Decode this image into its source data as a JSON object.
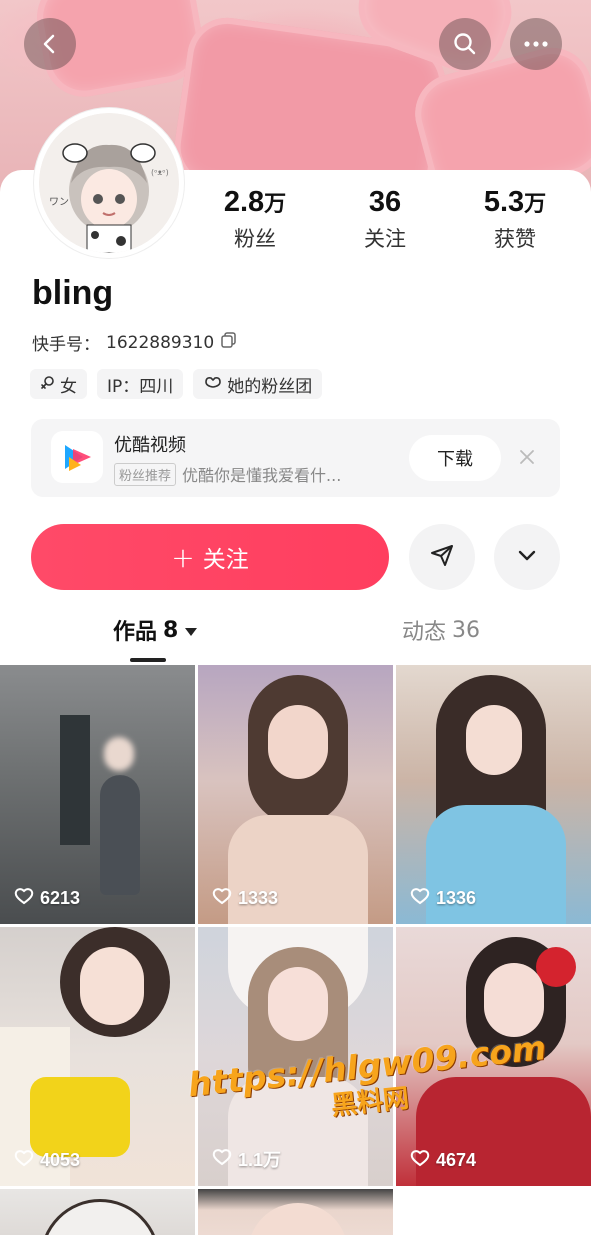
{
  "header": {
    "back_icon": "chevron-left-icon",
    "search_icon": "search-icon",
    "more_icon": "more-dots-icon"
  },
  "profile": {
    "name": "bling",
    "uid_label": "快手号：",
    "uid_value": "1622889310",
    "stats": [
      {
        "num": "2.8",
        "unit": "万",
        "label": "粉丝"
      },
      {
        "num": "36",
        "unit": "",
        "label": "关注"
      },
      {
        "num": "5.3",
        "unit": "万",
        "label": "获赞"
      }
    ],
    "tags": [
      {
        "icon": "female-icon",
        "label": "女"
      },
      {
        "icon": "",
        "label": "IP：四川"
      },
      {
        "icon": "heart-outline-icon",
        "label": "她的粉丝团"
      }
    ]
  },
  "ad": {
    "title": "优酷视频",
    "badge": "粉丝推荐",
    "subtitle": "优酷你是懂我爱看什...",
    "download_label": "下载"
  },
  "actions": {
    "follow_label": "关注",
    "follow_plus": "+"
  },
  "tabs": {
    "works_label": "作品",
    "works_count": "8",
    "moments_label": "动态",
    "moments_count": "36"
  },
  "works": [
    {
      "likes": "6213"
    },
    {
      "likes": "1333"
    },
    {
      "likes": "1336"
    },
    {
      "likes": "4053"
    },
    {
      "likes": "1.1万"
    },
    {
      "likes": "4674"
    }
  ],
  "watermark": {
    "url": "https://hlgw09.com",
    "text": "黑料网"
  },
  "colors": {
    "accent": "#ff4568",
    "watermark": "#f7a41c"
  }
}
